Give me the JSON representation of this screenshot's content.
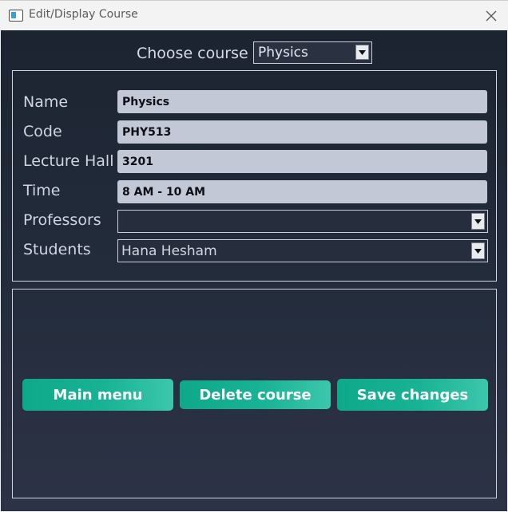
{
  "window": {
    "title": "Edit/Display Course"
  },
  "chooser": {
    "label": "Choose course",
    "selected": "Physics"
  },
  "fields": {
    "name_label": "Name",
    "name_value": "Physics",
    "code_label": "Code",
    "code_value": "PHY513",
    "hall_label": "Lecture Hall",
    "hall_value": "3201",
    "time_label": "Time",
    "time_value": "8 AM - 10 AM",
    "professors_label": "Professors",
    "professors_value": "",
    "students_label": "Students",
    "students_value": "Hana Hesham"
  },
  "buttons": {
    "main_menu": "Main menu",
    "delete_course": "Delete course",
    "save_changes": "Save changes"
  },
  "colors": {
    "accent": "#1ab394",
    "field_bg": "#c3c8d6",
    "window_bg": "#1f2735"
  },
  "icons": {
    "close": "close-icon",
    "dropdown": "chevron-down-icon",
    "app": "window-app-icon"
  }
}
